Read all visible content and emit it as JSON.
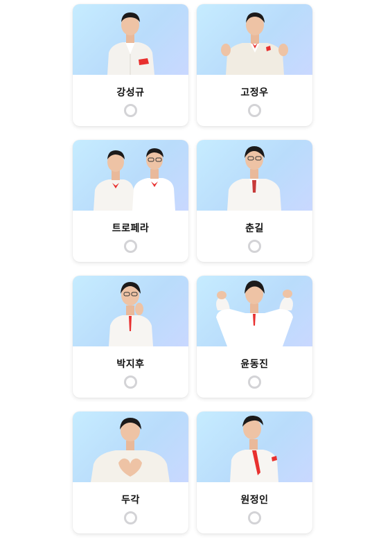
{
  "accent_color": "#e8302f",
  "photo_bg": [
    "#c6ecff",
    "#c9d8ff"
  ],
  "candidates": [
    {
      "name": "강성규",
      "selected": false
    },
    {
      "name": "고정우",
      "selected": false
    },
    {
      "name": "트로페라",
      "selected": false
    },
    {
      "name": "춘길",
      "selected": false
    },
    {
      "name": "박지후",
      "selected": false
    },
    {
      "name": "윤동진",
      "selected": false
    },
    {
      "name": "두각",
      "selected": false
    },
    {
      "name": "원정인",
      "selected": false
    }
  ]
}
